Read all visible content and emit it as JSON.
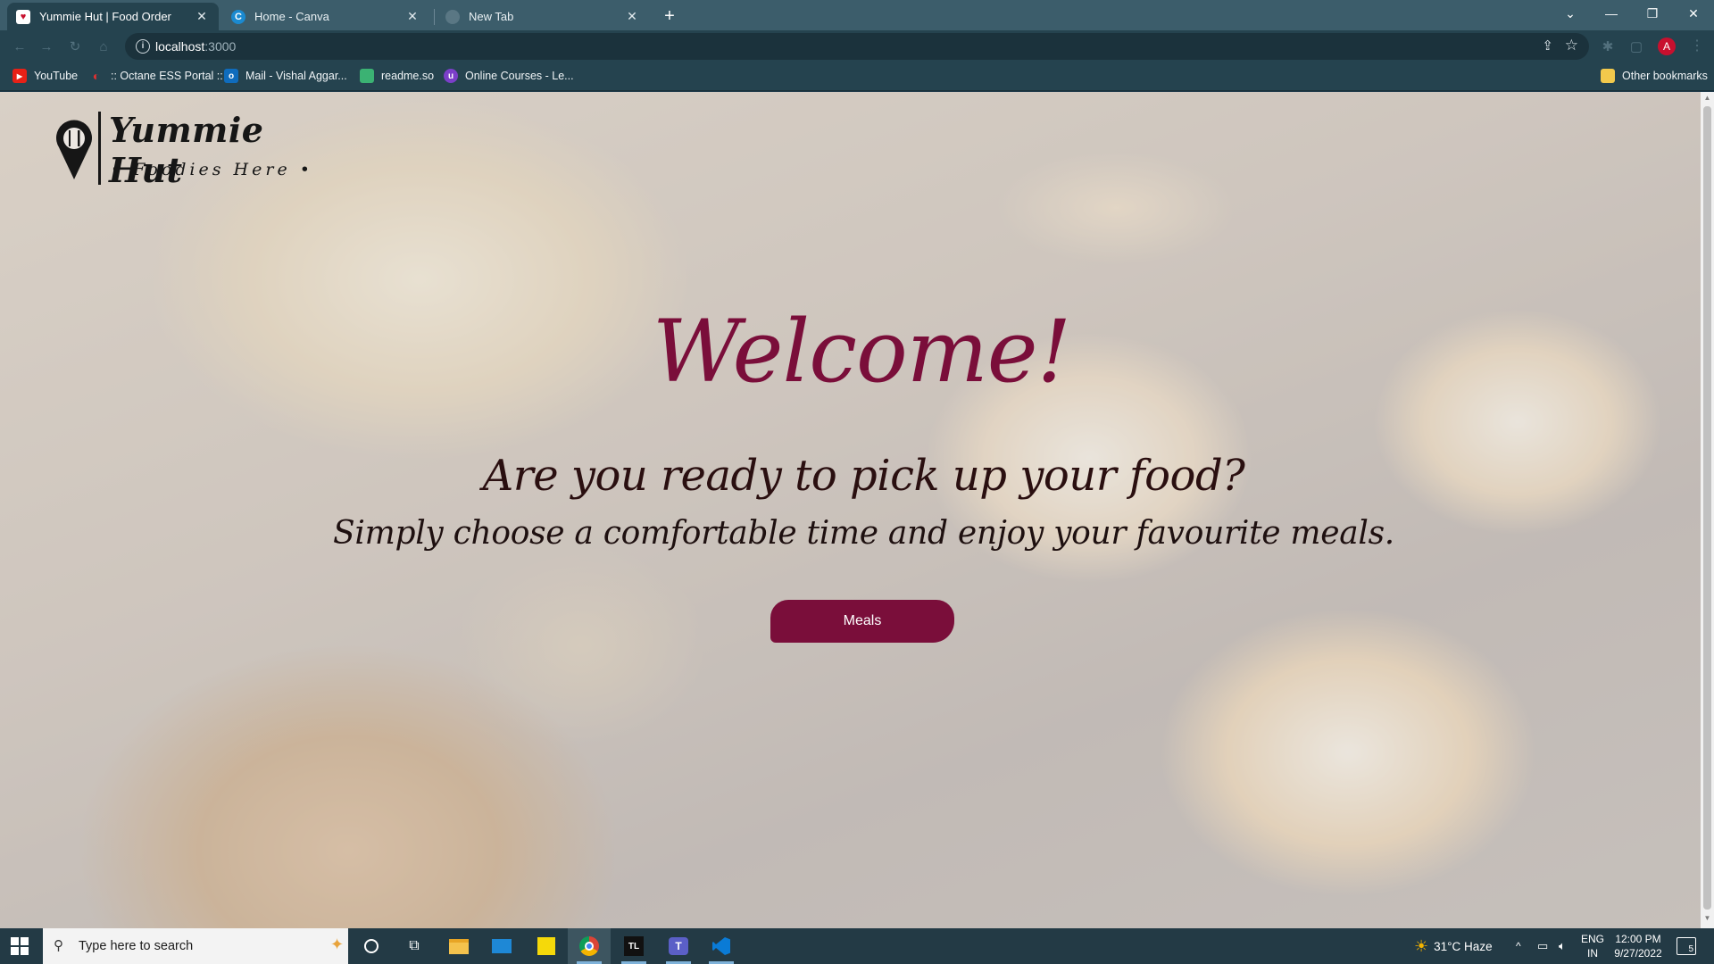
{
  "browser": {
    "tabs": [
      {
        "title": "Yummie Hut | Food Order",
        "active": true
      },
      {
        "title": "Home - Canva",
        "active": false
      },
      {
        "title": "New Tab",
        "active": false
      }
    ],
    "url_host": "localhost",
    "url_port": ":3000",
    "profile_initial": "A",
    "bookmarks": [
      {
        "label": "YouTube"
      },
      {
        "label": ":: Octane ESS Portal ::"
      },
      {
        "label": "Mail - Vishal Aggar..."
      },
      {
        "label": "readme.so"
      },
      {
        "label": "Online Courses - Le..."
      }
    ],
    "other_bookmarks": "Other bookmarks"
  },
  "page": {
    "logo": {
      "name": "Yummie Hut",
      "tagline": "• Foodies Here •"
    },
    "welcome": "Welcome!",
    "subtitle": "Are you ready to pick up your food?",
    "tagline": "Simply choose a comfortable time and enjoy your favourite meals.",
    "cta_label": "Meals",
    "accent_color": "#7a0e3a"
  },
  "taskbar": {
    "search_placeholder": "Type here to search",
    "weather": "31°C  Haze",
    "lang_line1": "ENG",
    "lang_line2": "IN",
    "time": "12:00 PM",
    "date": "9/27/2022",
    "notifications": "5"
  }
}
